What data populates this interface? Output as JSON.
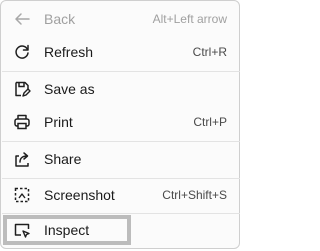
{
  "menu": {
    "items": [
      {
        "id": "back",
        "label": "Back",
        "shortcut": "Alt+Left arrow",
        "icon": "arrow-left-icon",
        "disabled": true
      },
      {
        "id": "refresh",
        "label": "Refresh",
        "shortcut": "Ctrl+R",
        "icon": "refresh-icon"
      },
      {
        "id": "save-as",
        "label": "Save as",
        "shortcut": "",
        "icon": "save-as-icon"
      },
      {
        "id": "print",
        "label": "Print",
        "shortcut": "Ctrl+P",
        "icon": "printer-icon"
      },
      {
        "id": "share",
        "label": "Share",
        "shortcut": "",
        "icon": "share-icon"
      },
      {
        "id": "screenshot",
        "label": "Screenshot",
        "shortcut": "Ctrl+Shift+S",
        "icon": "screenshot-icon"
      },
      {
        "id": "inspect",
        "label": "Inspect",
        "shortcut": "",
        "icon": "inspect-icon",
        "focused": true
      }
    ]
  },
  "colors": {
    "text": "#1a1a1a",
    "disabled_text": "#a0a0a0",
    "focus_border": "#bcbcbc"
  }
}
